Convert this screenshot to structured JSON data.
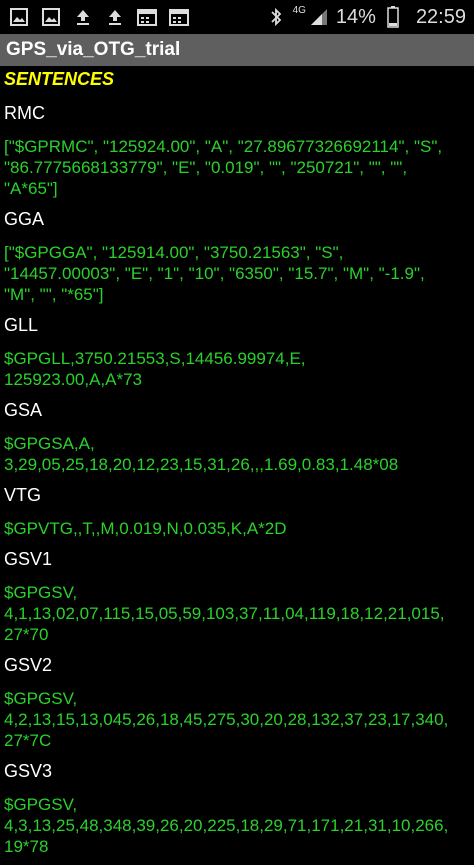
{
  "status_bar": {
    "left_icons": [
      "image-icon",
      "image-icon",
      "upload-icon",
      "upload-icon",
      "calendar-icon",
      "calendar-icon"
    ],
    "network_label": "4G",
    "battery_percent": "14%",
    "time": "22:59"
  },
  "app": {
    "title": "GPS_via_OTG_trial"
  },
  "section_title": "SENTENCES",
  "sentences": [
    {
      "name": "RMC",
      "value": "[\"$GPRMC\", \"125924.00\", \"A\", \"27.89677326692114\", \"S\",\n\"86.7775668133779\", \"E\", \"0.019\", \"\", \"250721\", \"\", \"\",\n\"A*65\"]"
    },
    {
      "name": "GGA",
      "value": "[\"$GPGGA\", \"125914.00\", \"3750.21563\", \"S\",\n\"14457.00003\", \"E\", \"1\", \"10\", \"6350\", \"15.7\", \"M\", \"-1.9\",\n\"M\", \"\", \"*65\"]"
    },
    {
      "name": "GLL",
      "value": "$GPGLL,3750.21553,S,14456.99974,E,\n125923.00,A,A*73"
    },
    {
      "name": "GSA",
      "value": "$GPGSA,A,\n3,29,05,25,18,20,12,23,15,31,26,,,1.69,0.83,1.48*08"
    },
    {
      "name": "VTG",
      "value": "$GPVTG,,T,,M,0.019,N,0.035,K,A*2D"
    },
    {
      "name": "GSV1",
      "value": "$GPGSV,\n4,1,13,02,07,115,15,05,59,103,37,11,04,119,18,12,21,015,\n27*70"
    },
    {
      "name": "GSV2",
      "value": "$GPGSV,\n4,2,13,15,13,045,26,18,45,275,30,20,28,132,37,23,17,340,\n27*7C"
    },
    {
      "name": "GSV3",
      "value": "$GPGSV,\n4,3,13,25,48,348,39,26,20,225,18,29,71,171,21,31,10,266,\n19*78"
    }
  ]
}
